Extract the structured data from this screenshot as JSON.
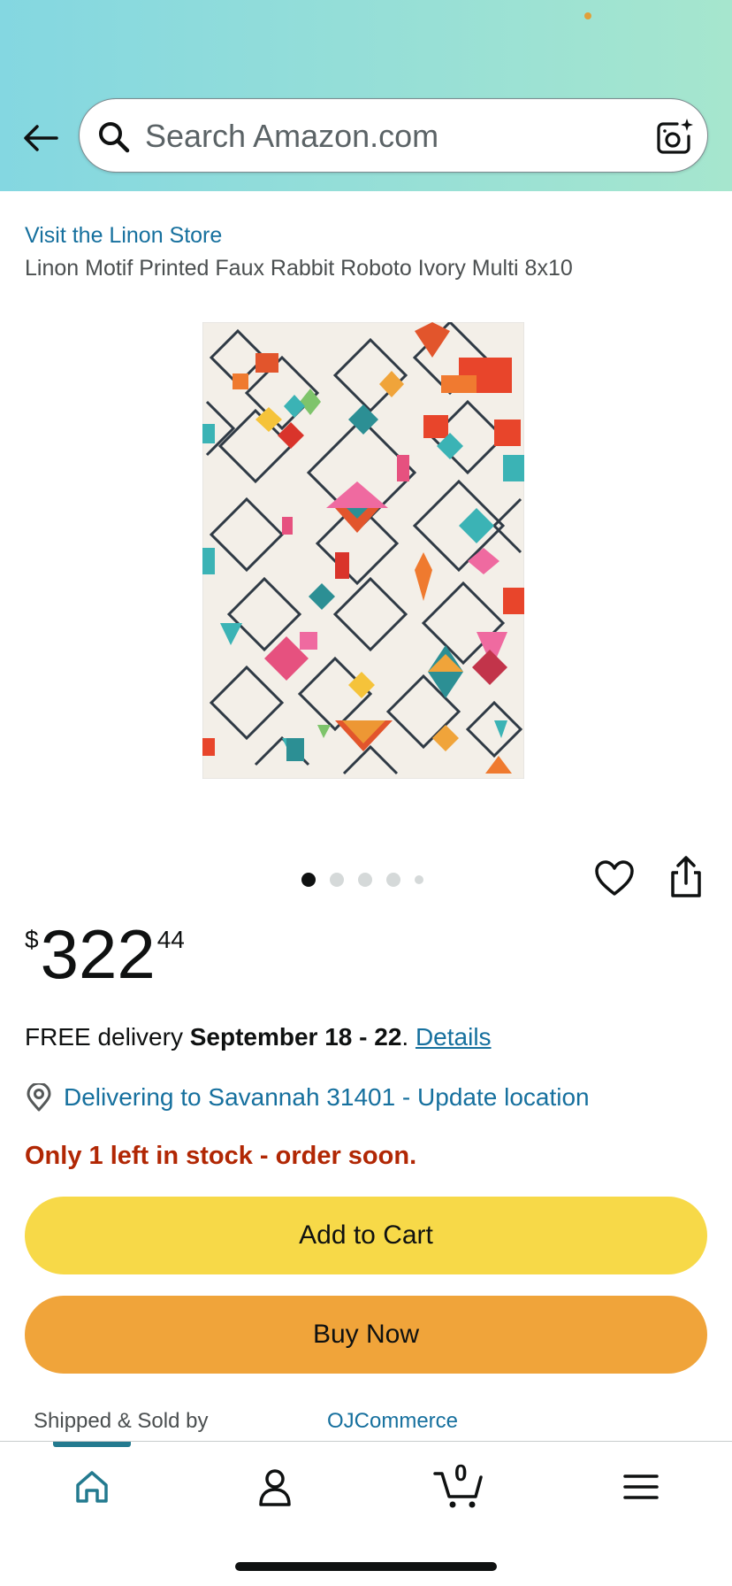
{
  "header": {
    "search_placeholder": "Search Amazon.com"
  },
  "product": {
    "store_link": "Visit the Linon Store",
    "title": "Linon Motif Printed Faux Rabbit Roboto Ivory Multi 8x10",
    "image_count": 5,
    "active_image_index": 0
  },
  "price": {
    "symbol": "$",
    "whole": "322",
    "fraction": "44"
  },
  "delivery": {
    "prefix": "FREE delivery ",
    "dates": "September 18 - 22",
    "suffix": ". ",
    "details_link": "Details"
  },
  "location": {
    "text": "Delivering to Savannah 31401 - Update location"
  },
  "stock": {
    "text": "Only 1 left in stock - order soon."
  },
  "buttons": {
    "add_to_cart": "Add to Cart",
    "buy_now": "Buy Now"
  },
  "seller": {
    "label": "Shipped & Sold by",
    "name": "OJCommerce"
  },
  "nav": {
    "cart_count": "0",
    "active": "home"
  },
  "colors": {
    "header_gradient_start": "#84d7e1",
    "header_gradient_end": "#a6e6ce",
    "link": "#16709e",
    "stock_warning": "#b12704",
    "add_to_cart": "#f7d948",
    "buy_now": "#f0a43a",
    "nav_active": "#237a8f"
  }
}
